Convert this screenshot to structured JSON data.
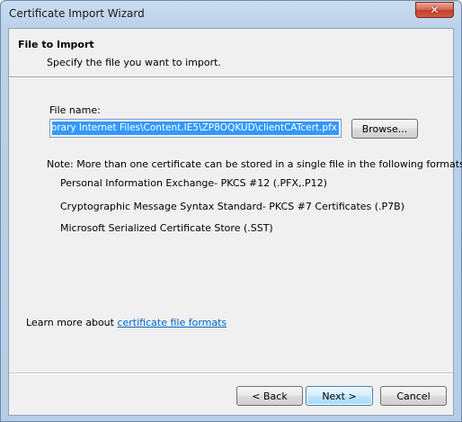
{
  "window": {
    "title": "Certificate Import Wizard",
    "close_glyph": "✕"
  },
  "header": {
    "title": "File to Import",
    "description": "Specify the file you want to import."
  },
  "form": {
    "file_name_label": "File name:",
    "file_name_value": "mporary Internet Files\\Content.IE5\\ZP8OQKUD\\clientCATcert.pfx",
    "browse_label": "Browse..."
  },
  "note": {
    "text": "Note:  More than one certificate can be stored in a single file in the following formats:",
    "formats": [
      "Personal Information Exchange- PKCS #12 (.PFX,.P12)",
      "Cryptographic Message Syntax Standard- PKCS #7 Certificates (.P7B)",
      "Microsoft Serialized Certificate Store (.SST)"
    ]
  },
  "learn_more": {
    "prefix": "Learn more about ",
    "link_text": "certificate file formats"
  },
  "buttons": {
    "back": "< Back",
    "next": "Next >",
    "cancel": "Cancel"
  },
  "colors": {
    "link": "#0066cc",
    "selection": "#3399ff",
    "close_button": "#c2402a"
  }
}
